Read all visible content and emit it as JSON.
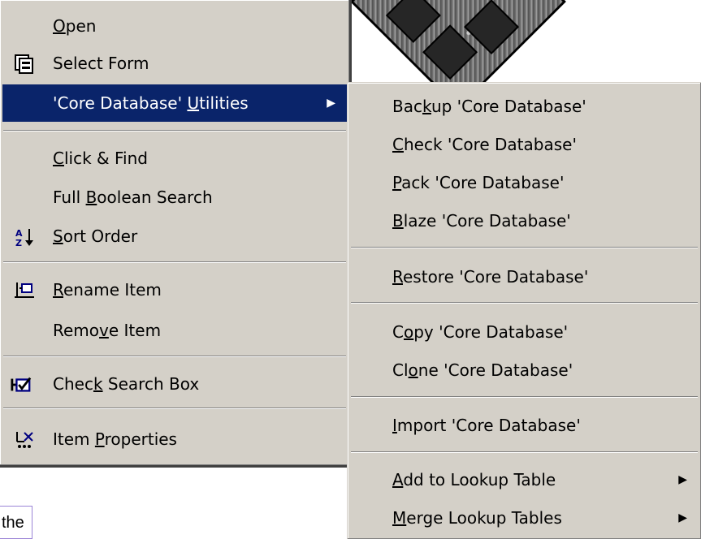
{
  "left_menu": {
    "items": [
      {
        "pre": "",
        "mn": "O",
        "post": "pen",
        "icon": ""
      },
      {
        "pre": "Select Form",
        "mn": "",
        "post": "",
        "icon": "form-icon"
      },
      {
        "pre": "'Core Database' ",
        "mn": "U",
        "post": "tilities",
        "icon": "",
        "submenu": true,
        "selected": true
      },
      {
        "pre": "",
        "mn": "C",
        "post": "lick & Find",
        "icon": ""
      },
      {
        "pre": "Full ",
        "mn": "B",
        "post": "oolean Search",
        "icon": ""
      },
      {
        "pre": "",
        "mn": "S",
        "post": "ort Order",
        "icon": "sort-az-icon"
      },
      {
        "pre": "",
        "mn": "R",
        "post": "ename Item",
        "icon": "rename-icon"
      },
      {
        "pre": "Remo",
        "mn": "v",
        "post": "e Item",
        "icon": ""
      },
      {
        "pre": "Chec",
        "mn": "k",
        "post": " Search Box",
        "icon": "checkbox-icon"
      },
      {
        "pre": "Item ",
        "mn": "P",
        "post": "roperties",
        "icon": "properties-icon"
      }
    ]
  },
  "right_menu": {
    "items": [
      {
        "pre": "Bac",
        "mn": "k",
        "post": "up 'Core Database'"
      },
      {
        "pre": "",
        "mn": "C",
        "post": "heck 'Core Database'"
      },
      {
        "pre": "",
        "mn": "P",
        "post": "ack 'Core Database'"
      },
      {
        "pre": "",
        "mn": "B",
        "post": "laze 'Core Database'"
      },
      {
        "pre": "",
        "mn": "R",
        "post": "estore 'Core Database'"
      },
      {
        "pre": "C",
        "mn": "o",
        "post": "py 'Core Database'"
      },
      {
        "pre": "Cl",
        "mn": "o",
        "post": "ne 'Core Database'"
      },
      {
        "pre": "",
        "mn": "I",
        "post": "mport 'Core Database'"
      },
      {
        "pre": "",
        "mn": "A",
        "post": "dd to Lookup Table",
        "submenu": true
      },
      {
        "pre": "",
        "mn": "M",
        "post": "erge Lookup Tables",
        "submenu": true
      }
    ]
  },
  "tooltip": {
    "text": "the"
  },
  "colors": {
    "menu_bg": "#d4d0c8",
    "highlight": "#0a246a",
    "highlight_text": "#ffffff"
  }
}
